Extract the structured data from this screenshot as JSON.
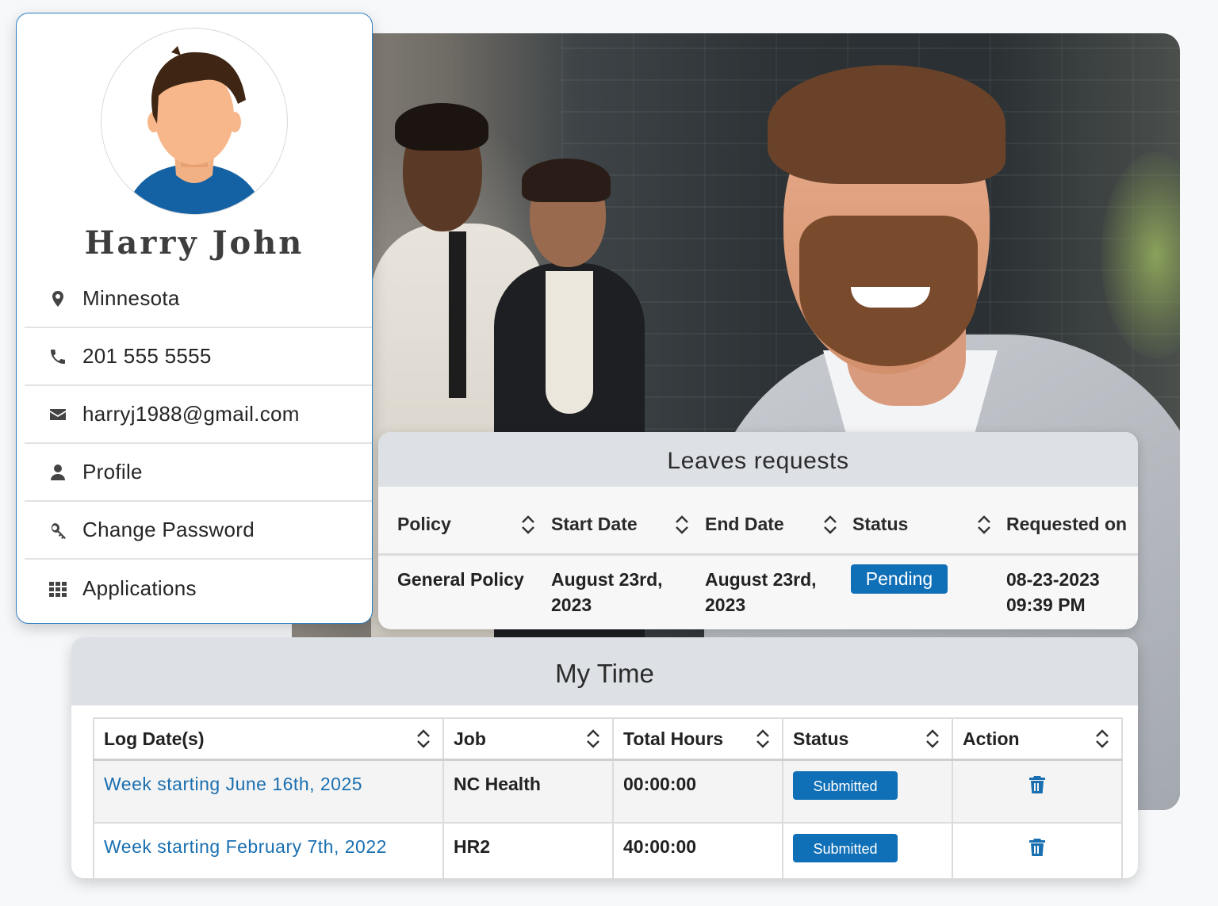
{
  "profile": {
    "name": "Harry John",
    "menu": [
      {
        "icon": "location-pin-icon",
        "label": "Minnesota"
      },
      {
        "icon": "phone-icon",
        "label": "201 555 5555"
      },
      {
        "icon": "envelope-icon",
        "label": "harryj1988@gmail.com"
      },
      {
        "icon": "user-icon",
        "label": "Profile"
      },
      {
        "icon": "key-icon",
        "label": "Change Password"
      },
      {
        "icon": "grid-icon",
        "label": "Applications"
      }
    ]
  },
  "leaves": {
    "title": "Leaves requests",
    "columns": [
      "Policy",
      "Start Date",
      "End Date",
      "Status",
      "Requested on"
    ],
    "row": {
      "policy": "General Policy",
      "start_date_line1": "August 23rd,",
      "start_date_line2": "2023",
      "end_date_line1": "August 23rd,",
      "end_date_line2": "2023",
      "status": "Pending",
      "requested_line1": "08-23-2023",
      "requested_line2": "09:39 PM"
    }
  },
  "mytime": {
    "title": "My Time",
    "columns": [
      "Log Date(s)",
      "Job",
      "Total Hours",
      "Status",
      "Action"
    ],
    "rows": [
      {
        "log_date": "Week starting June 16th, 2025",
        "job": "NC Health",
        "hours": "00:00:00",
        "status": "Submitted"
      },
      {
        "log_date": "Week starting February 7th, 2022",
        "job": "HR2",
        "hours": "40:00:00",
        "status": "Submitted"
      }
    ]
  },
  "colors": {
    "accent": "#0f6fb7",
    "link": "#1a6fb0",
    "panel_header": "#dde1e6",
    "card_border": "#2e7fc2"
  }
}
